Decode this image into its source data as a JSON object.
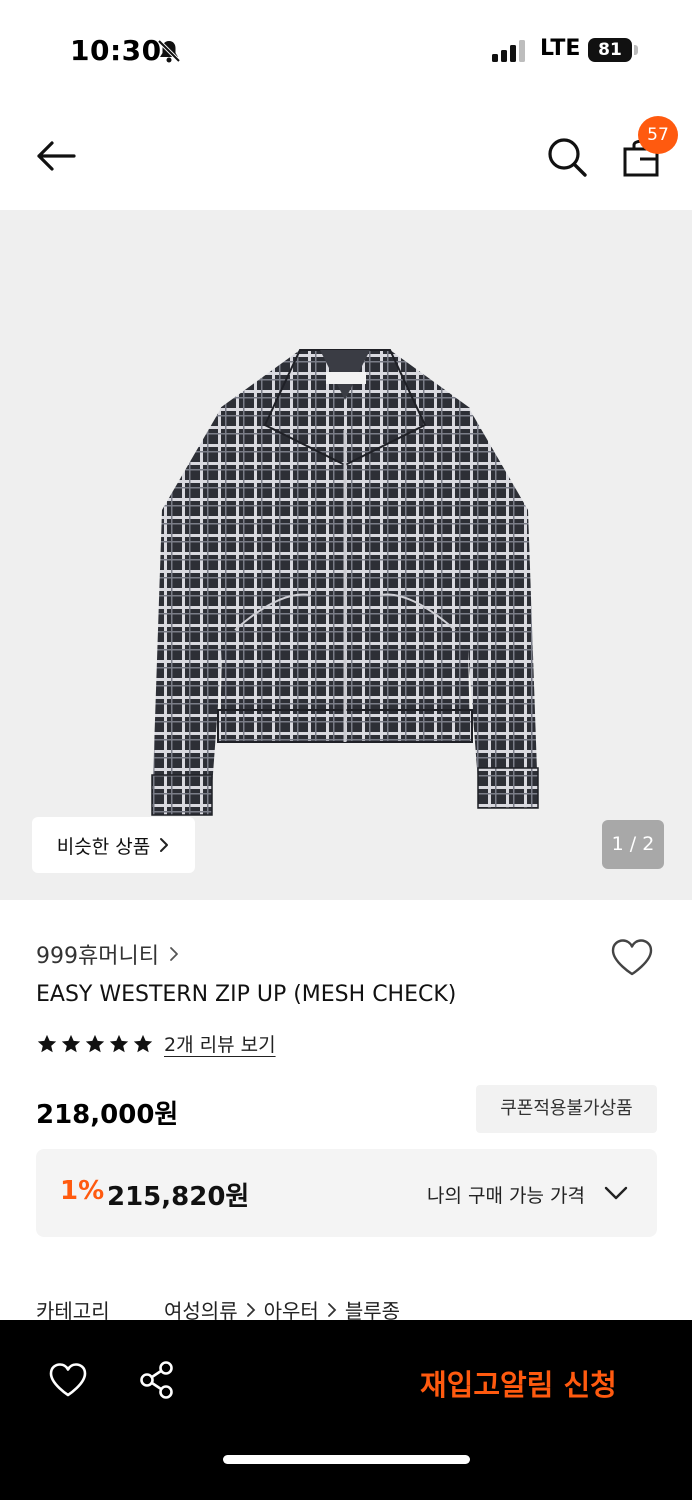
{
  "status_bar": {
    "time": "10:30",
    "network": "LTE",
    "battery": "81"
  },
  "header": {
    "cart_count": "57"
  },
  "gallery": {
    "similar_label": "비슷한 상품",
    "page_indicator": "1 / 2"
  },
  "product": {
    "brand": "999휴머니티",
    "name": "EASY WESTERN ZIP UP (MESH CHECK)",
    "rating": 5,
    "review_link": "2개 리뷰 보기",
    "price": "218,000원",
    "coupon_badge": "쿠폰적용불가상품",
    "discount_rate": "1%",
    "my_price": "215,820원",
    "my_price_label": "나의 구매 가능 가격"
  },
  "category": {
    "label": "카테고리",
    "path": [
      "여성의류",
      "아우터",
      "블루종"
    ]
  },
  "bottom_bar": {
    "restock_label": "재입고알림 신청"
  },
  "colors": {
    "accent": "#ff5a0f",
    "bottom_bar_bg": "#000000",
    "hero_bg": "#efefef"
  },
  "icons": [
    "bell-off-icon",
    "signal-icon",
    "battery-icon",
    "back-arrow-icon",
    "search-icon",
    "shopping-bag-icon",
    "chevron-right-icon",
    "heart-outline-icon",
    "star-icon",
    "chevron-down-icon",
    "share-icon"
  ]
}
